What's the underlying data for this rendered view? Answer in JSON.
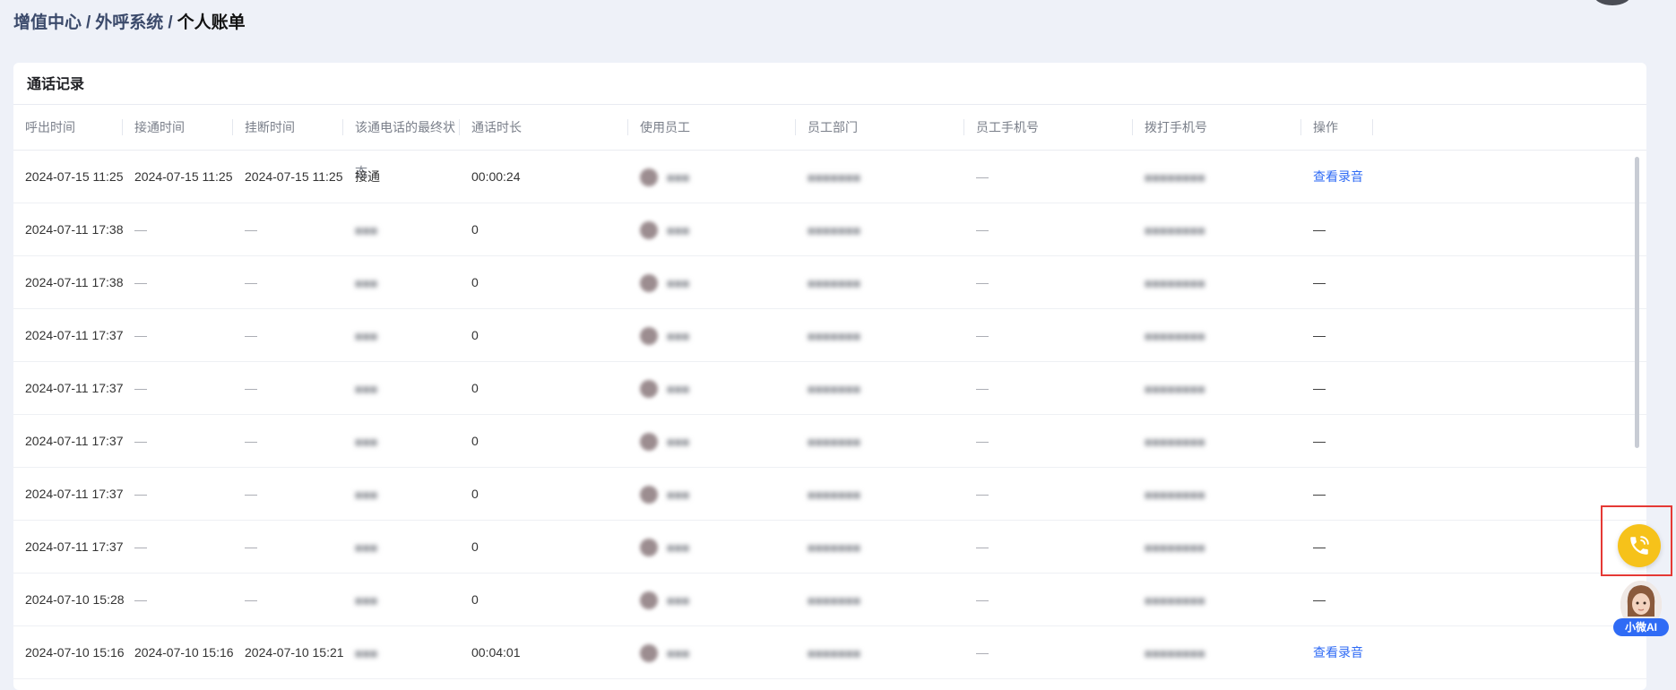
{
  "breadcrumb": {
    "level1": "增值中心",
    "level2": "外呼系统",
    "current": "个人账单",
    "separator": "/"
  },
  "card": {
    "title": "通话记录"
  },
  "table": {
    "headers": [
      "呼出时间",
      "接通时间",
      "挂断时间",
      "该通电话的最终状态",
      "通话时长",
      "使用员工",
      "员工部门",
      "员工手机号",
      "拨打手机号",
      "操作"
    ],
    "rows": [
      {
        "call_out": "2024-07-15 11:25",
        "connected": "2024-07-15 11:25",
        "hangup": "2024-07-15 11:25",
        "status": "接通",
        "duration": "00:00:24",
        "emp_mobile": "—",
        "action": "查看录音"
      },
      {
        "call_out": "2024-07-11 17:38",
        "connected": "—",
        "hangup": "—",
        "status": "",
        "duration": "0",
        "emp_mobile": "—",
        "action": "—"
      },
      {
        "call_out": "2024-07-11 17:38",
        "connected": "—",
        "hangup": "—",
        "status": "",
        "duration": "0",
        "emp_mobile": "—",
        "action": "—"
      },
      {
        "call_out": "2024-07-11 17:37",
        "connected": "—",
        "hangup": "—",
        "status": "",
        "duration": "0",
        "emp_mobile": "—",
        "action": "—"
      },
      {
        "call_out": "2024-07-11 17:37",
        "connected": "—",
        "hangup": "—",
        "status": "",
        "duration": "0",
        "emp_mobile": "—",
        "action": "—"
      },
      {
        "call_out": "2024-07-11 17:37",
        "connected": "—",
        "hangup": "—",
        "status": "",
        "duration": "0",
        "emp_mobile": "—",
        "action": "—"
      },
      {
        "call_out": "2024-07-11 17:37",
        "connected": "—",
        "hangup": "—",
        "status": "",
        "duration": "0",
        "emp_mobile": "—",
        "action": "—"
      },
      {
        "call_out": "2024-07-11 17:37",
        "connected": "—",
        "hangup": "—",
        "status": "",
        "duration": "0",
        "emp_mobile": "—",
        "action": "—"
      },
      {
        "call_out": "2024-07-10 15:28",
        "connected": "—",
        "hangup": "—",
        "status": "",
        "duration": "0",
        "emp_mobile": "—",
        "action": "—"
      },
      {
        "call_out": "2024-07-10 15:16",
        "connected": "2024-07-10 15:16",
        "hangup": "2024-07-10 15:21",
        "status": "",
        "duration": "00:04:01",
        "emp_mobile": "—",
        "action": "查看录音"
      }
    ]
  },
  "floating": {
    "phone_icon": "phone-icon",
    "phone_color": "#f6c21a",
    "ai_label": "小微AI"
  },
  "colors": {
    "link": "#2f6bf5",
    "highlight": "#e53935"
  }
}
